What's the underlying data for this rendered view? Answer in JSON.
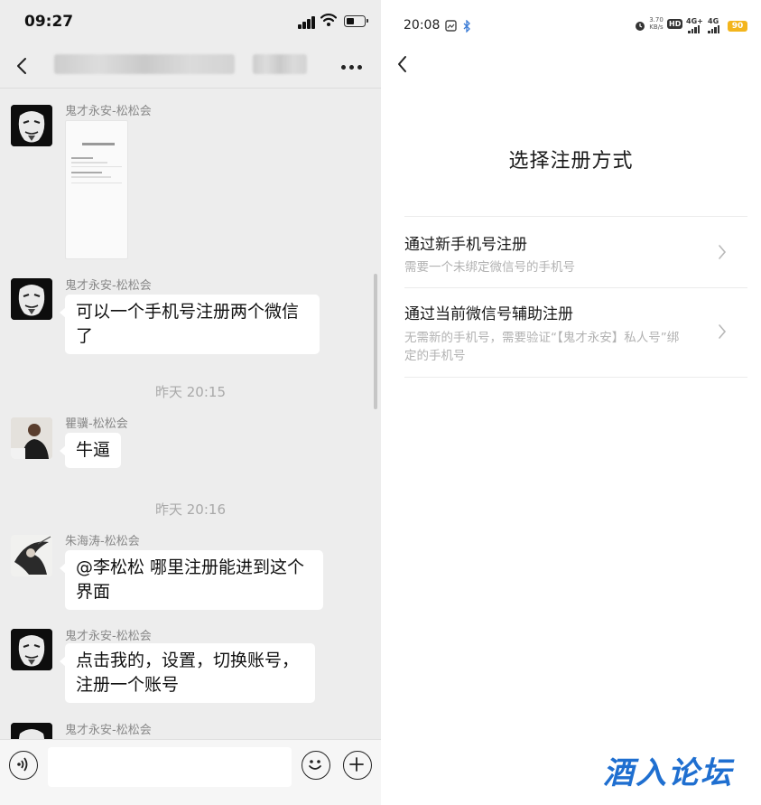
{
  "left": {
    "status_time": "09:27",
    "messages": [
      {
        "sender": "鬼才永安-松松会",
        "type": "image"
      },
      {
        "sender": "鬼才永安-松松会",
        "text": "可以一个手机号注册两个微信了"
      },
      {
        "timestamp": "昨天 20:15"
      },
      {
        "sender": "瞿骥-松松会",
        "text": "牛逼"
      },
      {
        "timestamp": "昨天 20:16"
      },
      {
        "sender": "朱海涛-松松会",
        "text": "@李松松 哪里注册能进到这个界面"
      },
      {
        "sender": "鬼才永安-松松会",
        "text": "点击我的，设置，切换账号，注册一个账号"
      },
      {
        "sender": "鬼才永安-松松会",
        "type": "partial"
      }
    ],
    "icons": {
      "back": "chevron-left-icon",
      "more": "more-dots-icon",
      "voice": "voice-icon",
      "emoji": "emoji-icon",
      "plus": "plus-icon"
    }
  },
  "right": {
    "status_time": "20:08",
    "network_speed": "3.70\nKB/s",
    "hd_label": "HD",
    "net1": "4G+",
    "net2": "4G",
    "battery": "90",
    "title": "选择注册方式",
    "options": [
      {
        "title": "通过新手机号注册",
        "desc": "需要一个未绑定微信号的手机号"
      },
      {
        "title": "通过当前微信号辅助注册",
        "desc": "无需新的手机号，需要验证“【鬼才永安】私人号”绑定的手机号"
      }
    ],
    "watermark": "酒入论坛"
  },
  "colors": {
    "chat_bg": "#ededed",
    "bubble": "#ffffff",
    "hint": "#b2b2b2",
    "watermark": "#1f6fd0",
    "battery": "#f3b51c"
  }
}
